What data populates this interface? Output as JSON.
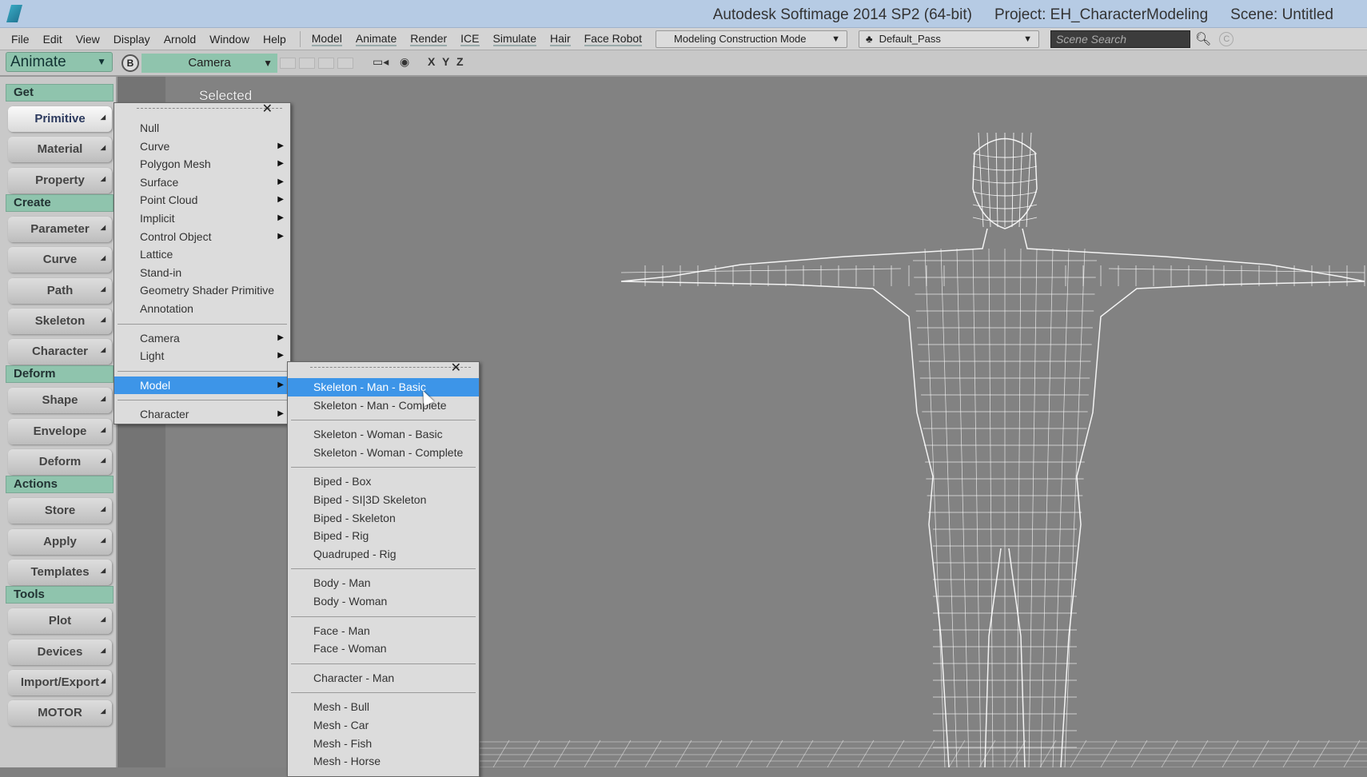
{
  "window": {
    "title_parts": [
      "Autodesk Softimage 2014 SP2 (64-bit)",
      "Project: EH_CharacterModeling",
      "Scene: Untitled"
    ]
  },
  "menubar": {
    "main": [
      "File",
      "Edit",
      "View",
      "Display",
      "Arnold",
      "Window",
      "Help"
    ],
    "modules": [
      "Model",
      "Animate",
      "Render",
      "ICE",
      "Simulate",
      "Hair",
      "Face Robot"
    ],
    "construction_mode": "Modeling Construction Mode",
    "pass": "Default_Pass",
    "search_placeholder": "Scene Search"
  },
  "toolbar": {
    "mode": "Animate",
    "camera_button": "B",
    "camera": "Camera",
    "axes": [
      "X",
      "Y",
      "Z"
    ]
  },
  "sidebar": [
    {
      "type": "header",
      "label": "Get"
    },
    {
      "type": "button",
      "label": "Primitive",
      "hot": true
    },
    {
      "type": "button",
      "label": "Material"
    },
    {
      "type": "button",
      "label": "Property"
    },
    {
      "type": "header",
      "label": "Create"
    },
    {
      "type": "button",
      "label": "Parameter"
    },
    {
      "type": "button",
      "label": "Curve"
    },
    {
      "type": "button",
      "label": "Path"
    },
    {
      "type": "button",
      "label": "Skeleton"
    },
    {
      "type": "button",
      "label": "Character"
    },
    {
      "type": "header",
      "label": "Deform"
    },
    {
      "type": "button",
      "label": "Shape"
    },
    {
      "type": "button",
      "label": "Envelope"
    },
    {
      "type": "button",
      "label": "Deform"
    },
    {
      "type": "header",
      "label": "Actions"
    },
    {
      "type": "button",
      "label": "Store"
    },
    {
      "type": "button",
      "label": "Apply"
    },
    {
      "type": "button",
      "label": "Templates"
    },
    {
      "type": "header",
      "label": "Tools"
    },
    {
      "type": "button",
      "label": "Plot"
    },
    {
      "type": "button",
      "label": "Devices"
    },
    {
      "type": "button",
      "label": "Import/Export"
    },
    {
      "type": "button",
      "label": "MOTOR"
    }
  ],
  "viewport": {
    "label": "Selected"
  },
  "primitive_menu": [
    [
      {
        "label": "Null"
      },
      {
        "label": "Curve",
        "sub": true
      },
      {
        "label": "Polygon Mesh",
        "sub": true
      },
      {
        "label": "Surface",
        "sub": true
      },
      {
        "label": "Point Cloud",
        "sub": true
      },
      {
        "label": "Implicit",
        "sub": true
      },
      {
        "label": "Control Object",
        "sub": true
      },
      {
        "label": "Lattice"
      },
      {
        "label": "Stand-in"
      },
      {
        "label": "Geometry Shader Primitive"
      },
      {
        "label": "Annotation"
      }
    ],
    [
      {
        "label": "Camera",
        "sub": true
      },
      {
        "label": "Light",
        "sub": true
      }
    ],
    [
      {
        "label": "Model",
        "sub": true,
        "highlighted": true
      }
    ],
    [
      {
        "label": "Character",
        "sub": true
      }
    ]
  ],
  "model_submenu": [
    [
      {
        "label": "Skeleton - Man - Basic",
        "highlighted": true
      },
      {
        "label": "Skeleton - Man - Complete"
      }
    ],
    [
      {
        "label": "Skeleton - Woman - Basic"
      },
      {
        "label": "Skeleton - Woman - Complete"
      }
    ],
    [
      {
        "label": "Biped - Box"
      },
      {
        "label": "Biped - SI|3D Skeleton"
      },
      {
        "label": "Biped - Skeleton"
      },
      {
        "label": "Biped - Rig"
      },
      {
        "label": "Quadruped - Rig"
      }
    ],
    [
      {
        "label": "Body - Man"
      },
      {
        "label": "Body - Woman"
      }
    ],
    [
      {
        "label": "Face - Man"
      },
      {
        "label": "Face - Woman"
      }
    ],
    [
      {
        "label": "Character - Man"
      }
    ],
    [
      {
        "label": "Mesh - Bull"
      },
      {
        "label": "Mesh - Car"
      },
      {
        "label": "Mesh - Fish"
      },
      {
        "label": "Mesh - Horse"
      }
    ]
  ],
  "colors": {
    "accent_green": "#8fc4ad",
    "highlight": "#3d95e8",
    "titlebar": "#b6cbe4"
  }
}
